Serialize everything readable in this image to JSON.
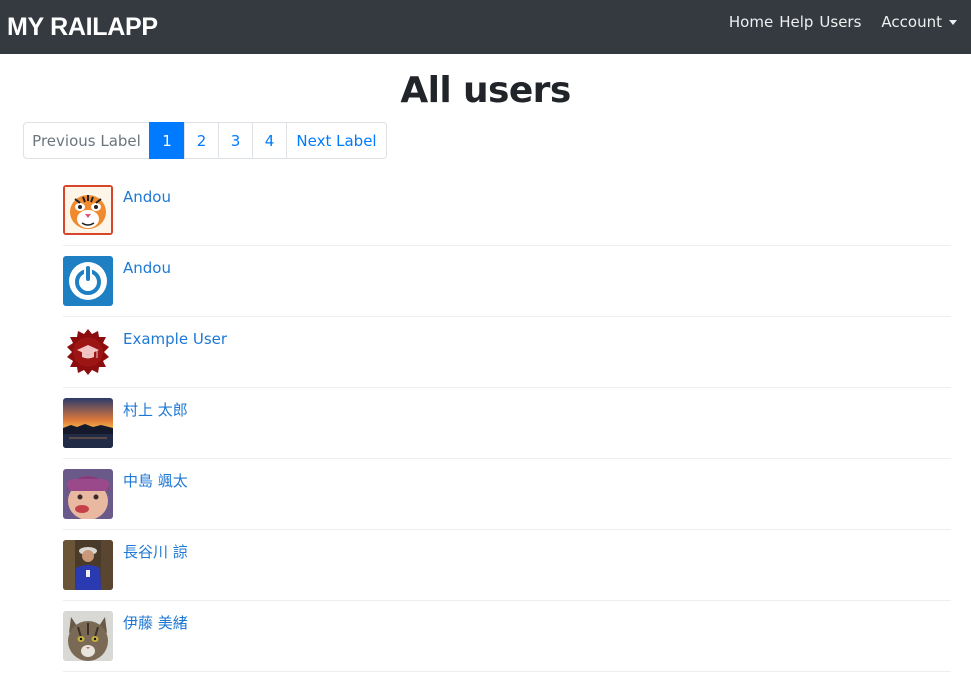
{
  "navbar": {
    "brand": "MY RAILAPP",
    "links": [
      "Home",
      "Help",
      "Users"
    ],
    "account_label": "Account"
  },
  "page": {
    "title": "All users"
  },
  "pagination": {
    "previous_label": "Previous Label",
    "pages": [
      "1",
      "2",
      "3",
      "4"
    ],
    "current_page": "1",
    "next_label": "Next Label"
  },
  "users": [
    {
      "name": "Andou",
      "avatar": "tiger-avatar"
    },
    {
      "name": "Andou",
      "avatar": "power-icon-avatar"
    },
    {
      "name": "Example User",
      "avatar": "graduation-cap-seal-avatar"
    },
    {
      "name": "村上 太郎",
      "avatar": "sunset-photo-avatar"
    },
    {
      "name": "中島 颯太",
      "avatar": "child-photo-avatar"
    },
    {
      "name": "長谷川 諒",
      "avatar": "person-photo-avatar"
    },
    {
      "name": "伊藤 美緒",
      "avatar": "cat-photo-avatar"
    }
  ],
  "colors": {
    "navbar": "#343a40",
    "link": "#1e78d4",
    "active_page": "#007bff"
  }
}
